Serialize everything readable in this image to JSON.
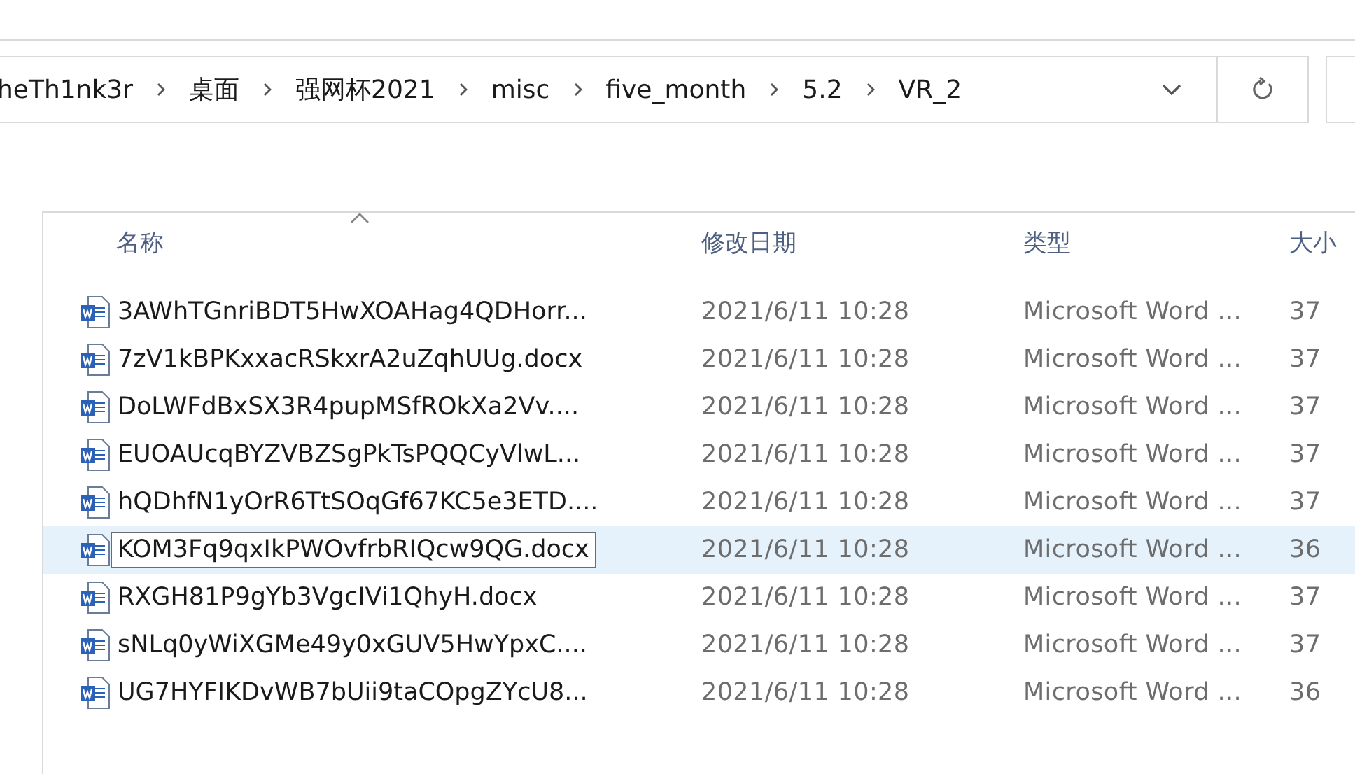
{
  "address_bar": {
    "breadcrumbs": [
      "heTh1nk3r",
      "桌面",
      "强网杯2021",
      "misc",
      "five_month",
      "5.2",
      "VR_2"
    ]
  },
  "file_list": {
    "columns": [
      "名称",
      "修改日期",
      "类型",
      "大小"
    ],
    "rows": [
      {
        "name": "3AWhTGnriBDT5HwXOAHag4QDHorr...",
        "modified": "2021/6/11 10:28",
        "type": "Microsoft Word ...",
        "size": "37",
        "selected": false
      },
      {
        "name": "7zV1kBPKxxacRSkxrA2uZqhUUg.docx",
        "modified": "2021/6/11 10:28",
        "type": "Microsoft Word ...",
        "size": "37",
        "selected": false
      },
      {
        "name": "DoLWFdBxSX3R4pupMSfROkXa2Vv....",
        "modified": "2021/6/11 10:28",
        "type": "Microsoft Word ...",
        "size": "37",
        "selected": false
      },
      {
        "name": "EUOAUcqBYZVBZSgPkTsPQQCyVlwL...",
        "modified": "2021/6/11 10:28",
        "type": "Microsoft Word ...",
        "size": "37",
        "selected": false
      },
      {
        "name": "hQDhfN1yOrR6TtSOqGf67KC5e3ETD....",
        "modified": "2021/6/11 10:28",
        "type": "Microsoft Word ...",
        "size": "37",
        "selected": false
      },
      {
        "name": "KOM3Fq9qxIkPWOvfrbRIQcw9QG.docx",
        "modified": "2021/6/11 10:28",
        "type": "Microsoft Word ...",
        "size": "36",
        "selected": true
      },
      {
        "name": "RXGH81P9gYb3VgcIVi1QhyH.docx",
        "modified": "2021/6/11 10:28",
        "type": "Microsoft Word ...",
        "size": "37",
        "selected": false
      },
      {
        "name": "sNLq0yWiXGMe49y0xGUV5HwYpxC....",
        "modified": "2021/6/11 10:28",
        "type": "Microsoft Word ...",
        "size": "37",
        "selected": false
      },
      {
        "name": "UG7HYFIKDvWB7bUii9taCOpgZYcU8...",
        "modified": "2021/6/11 10:28",
        "type": "Microsoft Word ...",
        "size": "36",
        "selected": false
      }
    ]
  }
}
